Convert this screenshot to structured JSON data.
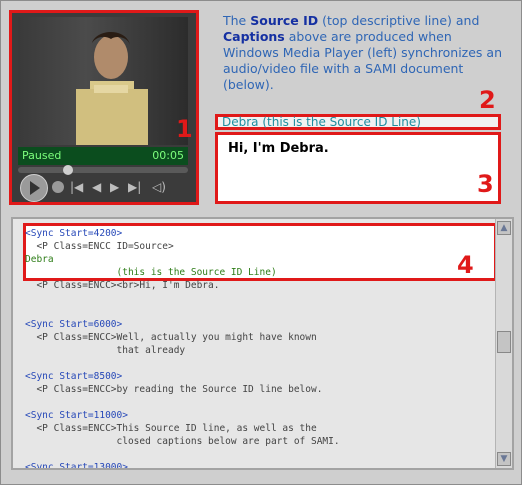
{
  "player": {
    "status": "Paused",
    "time": "00:05",
    "number": "1"
  },
  "description": {
    "p1": "The ",
    "source_id": "Source ID",
    "p2": " (top descriptive line) and ",
    "captions": "Captions",
    "p3": " above are produced when Windows Media Player (left) synchronizes an audio/video file with a SAMI document (below)."
  },
  "caption": {
    "source_line": "Debra (this is the Source ID Line)",
    "source_number": "2",
    "text": "Hi, I'm Debra.",
    "caption_number": "3"
  },
  "code": {
    "number": "4",
    "lines": [
      {
        "cls": "sync",
        "text": "<Sync Start=4200>"
      },
      {
        "cls": "dark",
        "text": "  <P Class=ENCC ID=Source>"
      },
      {
        "cls": "green",
        "text": "Debra"
      },
      {
        "cls": "green",
        "text": "                (this is the Source ID Line)"
      },
      {
        "cls": "dark",
        "text": "  <P Class=ENCC><br>Hi, I'm Debra."
      },
      {
        "cls": "blank",
        "text": ""
      },
      {
        "cls": "blank",
        "text": ""
      },
      {
        "cls": "sync",
        "text": "<Sync Start=6000>"
      },
      {
        "cls": "dark",
        "text": "  <P Class=ENCC>Well, actually you might have known"
      },
      {
        "cls": "dark",
        "text": "                that already"
      },
      {
        "cls": "blank",
        "text": ""
      },
      {
        "cls": "sync",
        "text": "<Sync Start=8500>"
      },
      {
        "cls": "dark",
        "text": "  <P Class=ENCC>by reading the Source ID line below."
      },
      {
        "cls": "blank",
        "text": ""
      },
      {
        "cls": "sync",
        "text": "<Sync Start=11000>"
      },
      {
        "cls": "dark",
        "text": "  <P Class=ENCC>This Source ID line, as well as the"
      },
      {
        "cls": "dark",
        "text": "                closed captions below are part of SAMI."
      },
      {
        "cls": "blank",
        "text": ""
      },
      {
        "cls": "sync",
        "text": "<Sync Start=13000>"
      }
    ]
  },
  "icons": {
    "play": "play-icon",
    "stop": "stop-icon",
    "prev": "previous-icon",
    "rewind": "rewind-icon",
    "forward": "forward-icon",
    "next": "next-icon",
    "mute": "mute-icon"
  }
}
